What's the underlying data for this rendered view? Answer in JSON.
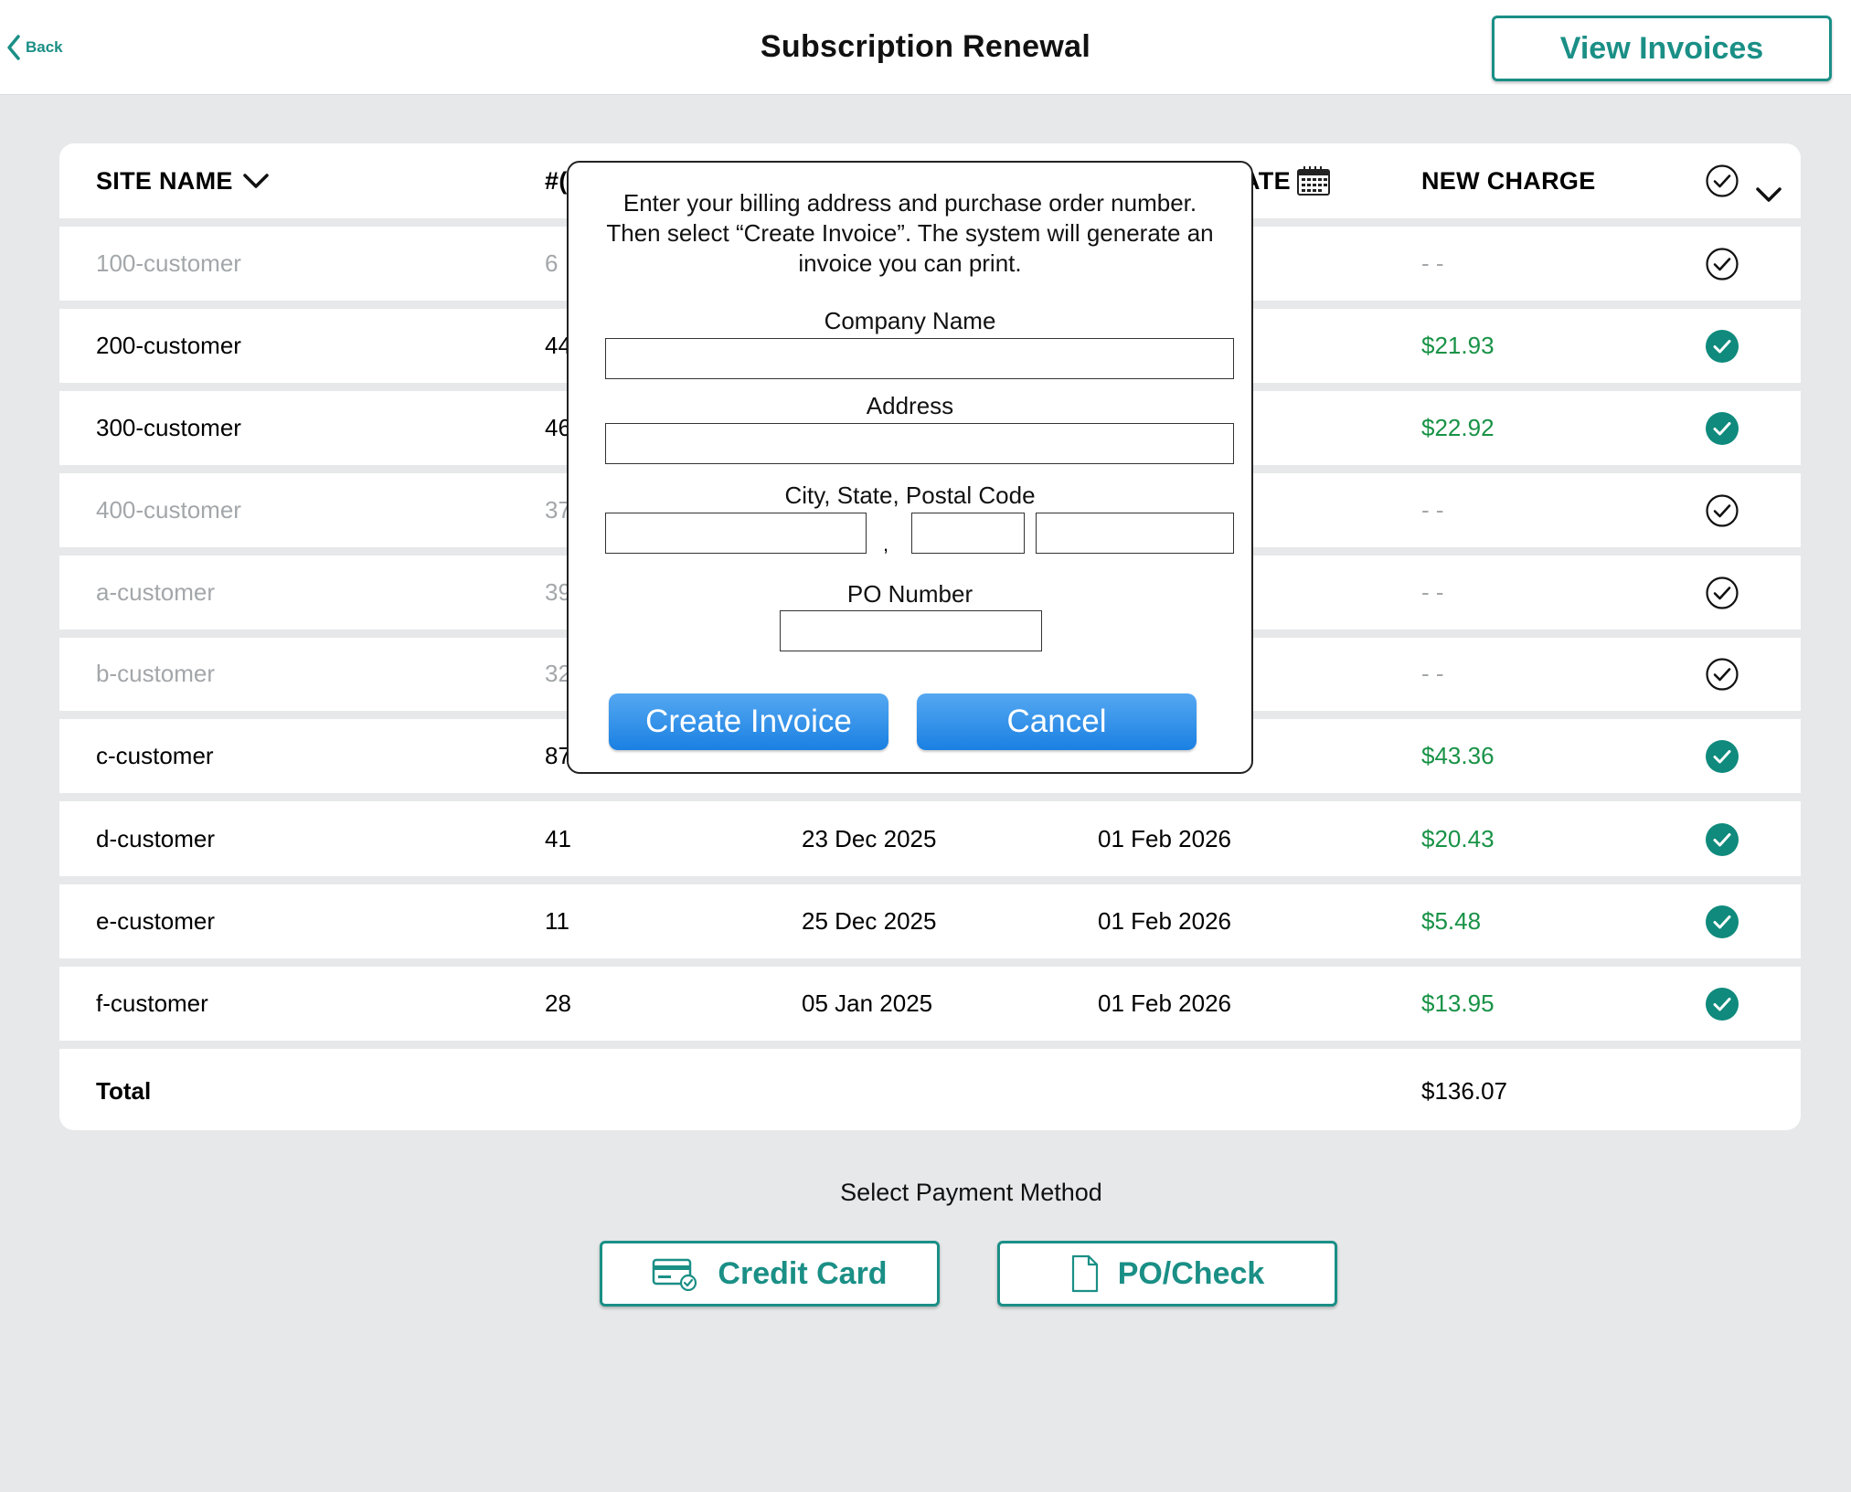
{
  "header": {
    "back_label": "Back",
    "title": "Subscription Renewal",
    "view_invoices_label": "View Invoices"
  },
  "table": {
    "headers": {
      "site_name": "SITE NAME",
      "count": "#(",
      "date": "ATE",
      "new_charge": "NEW CHARGE"
    },
    "rows": [
      {
        "site": "100-customer",
        "count": "6",
        "start": "",
        "end": "",
        "charge": "- -",
        "selected": false
      },
      {
        "site": "200-customer",
        "count": "44",
        "start": "",
        "end": "",
        "charge": "$21.93",
        "selected": true
      },
      {
        "site": "300-customer",
        "count": "46",
        "start": "",
        "end": "",
        "charge": "$22.92",
        "selected": true
      },
      {
        "site": "400-customer",
        "count": "37",
        "start": "",
        "end": "",
        "charge": "- -",
        "selected": false
      },
      {
        "site": "a-customer",
        "count": "39",
        "start": "",
        "end": "",
        "charge": "- -",
        "selected": false
      },
      {
        "site": "b-customer",
        "count": "32",
        "start": "",
        "end": "",
        "charge": "- -",
        "selected": false
      },
      {
        "site": "c-customer",
        "count": "87",
        "start": "",
        "end": "",
        "charge": "$43.36",
        "selected": true
      },
      {
        "site": "d-customer",
        "count": "41",
        "start": "23 Dec 2025",
        "end": "01 Feb 2026",
        "charge": "$20.43",
        "selected": true
      },
      {
        "site": "e-customer",
        "count": "11",
        "start": "25 Dec 2025",
        "end": "01 Feb 2026",
        "charge": "$5.48",
        "selected": true
      },
      {
        "site": "f-customer",
        "count": "28",
        "start": "05 Jan 2025",
        "end": "01 Feb 2026",
        "charge": "$13.95",
        "selected": true
      }
    ],
    "total_label": "Total",
    "total_value": "$136.07"
  },
  "payment": {
    "label": "Select Payment Method",
    "credit_card_label": "Credit Card",
    "po_check_label": "PO/Check"
  },
  "modal": {
    "instructions": "Enter your billing address and purchase order number. Then select “Create Invoice”. The system will generate an invoice you can print.",
    "company_label": "Company Name",
    "company_value": "",
    "address_label": "Address",
    "address_value": "",
    "city_state_zip_label": "City, State, Postal Code",
    "city_value": "",
    "comma": ",",
    "state_value": "",
    "postal_value": "",
    "po_label": "PO Number",
    "po_value": "",
    "create_label": "Create Invoice",
    "cancel_label": "Cancel"
  },
  "colors": {
    "accent": "#1a8f86",
    "charge_green": "#189246",
    "muted_text": "#a3a7aa",
    "page_bg": "#e6e8e9",
    "modal_button": "#1a80e2"
  }
}
